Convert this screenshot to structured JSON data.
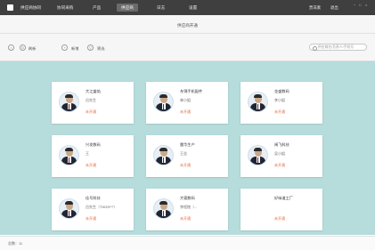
{
  "app": {
    "brand": "供应商协同"
  },
  "nav": {
    "items": [
      {
        "label": "协同采购"
      },
      {
        "label": "产品"
      },
      {
        "label": "供应商"
      },
      {
        "label": "日志"
      },
      {
        "label": "设置"
      }
    ],
    "active_index": 2
  },
  "top_right": {
    "user": "贾非素",
    "logout": "退出"
  },
  "header": {
    "title": "供应商开通"
  },
  "toolbar": {
    "refresh_label": "刷新",
    "add_label": "新增",
    "filter_label": "筛选",
    "search_placeholder": "供应商名/负责人/手机号"
  },
  "cards": [
    {
      "name": "大江盛焰",
      "contact": "吕先生",
      "status": "未开通"
    },
    {
      "name": "东锦手机配件",
      "contact": "林小姐",
      "status": "未开通"
    },
    {
      "name": "金盛数码",
      "contact": "李小姐",
      "status": "未开通"
    },
    {
      "name": "兴发数码",
      "contact": "王",
      "status": "未开通"
    },
    {
      "name": "雷华生产",
      "contact": "王总",
      "status": "未开通"
    },
    {
      "name": "闽飞科技",
      "contact": "吴小姐",
      "status": "未开通"
    },
    {
      "name": "佳号科技",
      "contact": "吕先生（TW33***）",
      "status": "未开通"
    },
    {
      "name": "大德数码",
      "contact": "李程煌（...",
      "status": "未开通"
    },
    {
      "name": "好味道工厂",
      "contact": "",
      "status": "未开通"
    }
  ],
  "footer": {
    "total": "总数：11"
  },
  "colors": {
    "content_bg": "#b6dcdc",
    "status": "#e36a3a",
    "topbar": "#3f3f3f"
  }
}
